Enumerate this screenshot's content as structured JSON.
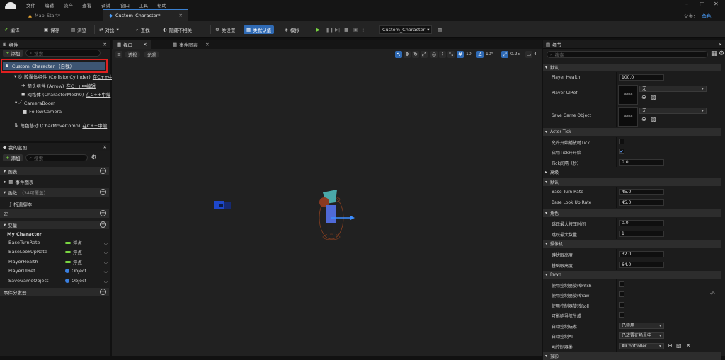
{
  "menu": [
    "文件",
    "编辑",
    "资产",
    "查看",
    "调试",
    "窗口",
    "工具",
    "帮助"
  ],
  "tabs": {
    "map": "Map_Start*",
    "character": "Custom_Character*"
  },
  "parent_class": {
    "label": "父类：",
    "value": "角色"
  },
  "toolbar": {
    "compile": "编译",
    "save": "保存",
    "browse": "浏览",
    "diff": "对比",
    "find": "查找",
    "hide_unrelated": "隐藏不相关",
    "class_settings": "类设置",
    "class_defaults": "类默认值",
    "simulation": "模拟",
    "debug_object": "Custom_Character"
  },
  "components": {
    "title": "组件",
    "add": "添加",
    "search_placeholder": "搜索",
    "root": "Custom_Character （自我）",
    "items": [
      {
        "name": "胶囊体组件 (CollisionCylinder)",
        "edit": "在C++中"
      },
      {
        "name": "箭头组件 (Arrow)",
        "edit": "在C++中编辑"
      },
      {
        "name": "网格体 (CharacterMesh0)",
        "edit": "在C++中编"
      },
      {
        "name": "CameraBoom",
        "edit": ""
      },
      {
        "name": "FollowCamera",
        "edit": ""
      },
      {
        "name": "角色移动 (CharMoveComp)",
        "edit": "在C++中编"
      }
    ]
  },
  "my_blueprint": {
    "title": "我的蓝图",
    "add": "添加",
    "search_placeholder": "搜索",
    "graphs": "图表",
    "event_graph": "事件图表",
    "functions": "函数",
    "functions_note": "（34可覆盖）",
    "construction_script": "构造脚本",
    "macros": "宏",
    "variables": "变量",
    "category": "My Character",
    "vars": [
      {
        "name": "BaseTurnRate",
        "type": "浮点",
        "color": "#7ad742"
      },
      {
        "name": "BaseLookUpRate",
        "type": "浮点",
        "color": "#7ad742"
      },
      {
        "name": "PlayerHealth",
        "type": "浮点",
        "color": "#7ad742"
      },
      {
        "name": "PlayerUIRef",
        "type": "Object",
        "color": "#3a7fe0"
      },
      {
        "name": "SaveGameObject",
        "type": "Object",
        "color": "#3a7fe0"
      }
    ],
    "event_dispatchers": "事件分发器"
  },
  "viewport": {
    "tab": "视口",
    "event_graph_tab": "事件图表",
    "perspective": "透视",
    "lit": "光照",
    "grid": "10",
    "rotation": "10°",
    "scale": "0.25",
    "camera_speed": "4"
  },
  "details": {
    "title": "细节",
    "search_placeholder": "搜索",
    "default_section": "默认",
    "player_health_label": "Player Health",
    "player_health": "100.0",
    "player_uiref_label": "Player UIRef",
    "none": "None",
    "none_cn": "无",
    "save_game_label": "Save Game Object",
    "actor_tick": "Actor Tick",
    "tick_start": "允许开始播放时Tick",
    "tick_enabled": "启用Tick开开始",
    "tick_interval_label": "Tick间隔（秒）",
    "tick_interval": "0.0",
    "advanced": "高级",
    "default2": "默认",
    "base_turn_label": "Base Turn Rate",
    "base_turn": "45.0",
    "base_lookup_label": "Base Look Up Rate",
    "base_lookup": "45.0",
    "character": "角色",
    "jump_hold_label": "跳跃最大按压时间",
    "jump_hold": "0.0",
    "jump_count_label": "跳跃最大数量",
    "jump_count": "1",
    "camera": "摄像机",
    "eye_height_label": "蹲伏眼高度",
    "eye_height": "32.0",
    "base_eye_label": "基础眼高度",
    "base_eye": "64.0",
    "pawn": "Pawn",
    "use_pitch": "使用控制器旋转Pitch",
    "use_yaw": "使用控制器旋转Yaw",
    "use_roll": "使用控制器旋转Roll",
    "can_nav": "可影响导航生成",
    "auto_possess_label": "自动控制玩家",
    "auto_possess": "已禁用",
    "auto_ai_label": "自动控制AI",
    "auto_ai": "已放置在场景中",
    "ai_class_label": "AI控制器类",
    "ai_class": "AIController",
    "more": "摄影"
  }
}
